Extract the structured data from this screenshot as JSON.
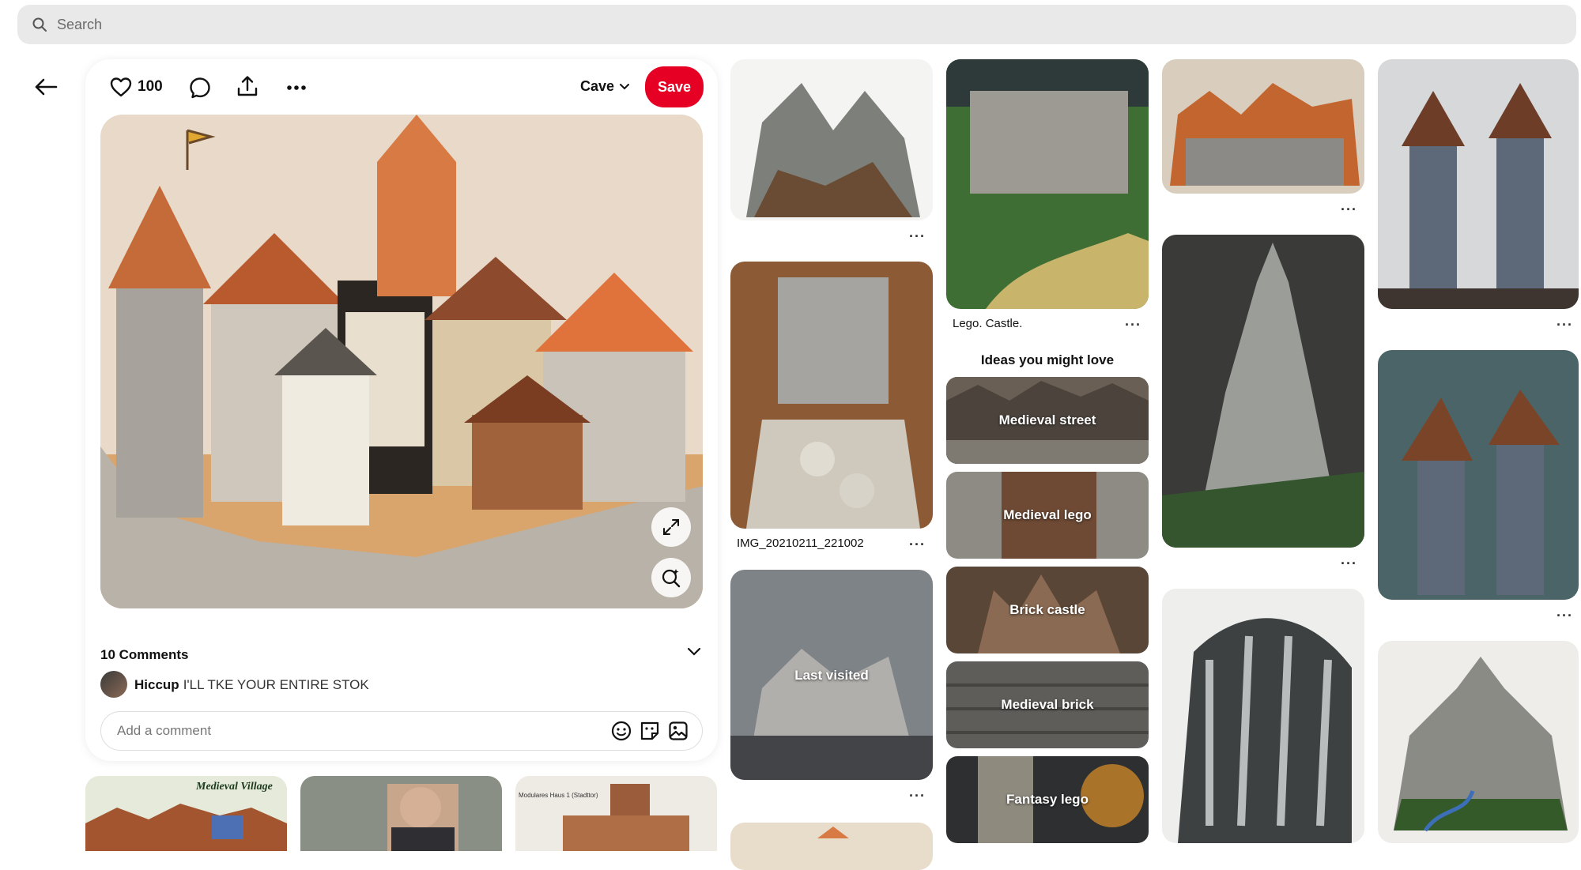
{
  "search": {
    "placeholder": "Search"
  },
  "pin": {
    "like_count": "100",
    "board_name": "Cave",
    "save_label": "Save",
    "comments": {
      "title": "10 Comments",
      "items": [
        {
          "user": "Hiccup",
          "text": "I'LL TKE YOUR ENTIRE STOK"
        }
      ],
      "add_placeholder": "Add a comment"
    }
  },
  "feed": {
    "col1": {
      "caption2": "IMG_20210211_221002",
      "last_visited": "Last visited"
    },
    "col2": {
      "caption1": "Lego. Castle.",
      "ideas_title": "Ideas you might love",
      "ideas": [
        {
          "label": "Medieval street"
        },
        {
          "label": "Medieval lego"
        },
        {
          "label": "Brick castle"
        },
        {
          "label": "Medieval brick"
        },
        {
          "label": "Fantasy lego"
        }
      ]
    },
    "more_options": "···"
  },
  "bottom_tiles": {
    "tile1_title": "Medieval Village",
    "tile3_title": "Modulares Haus 1 (Stadttor)"
  },
  "colors": {
    "accent": "#e60023",
    "search_bg": "#e9e9e9"
  }
}
